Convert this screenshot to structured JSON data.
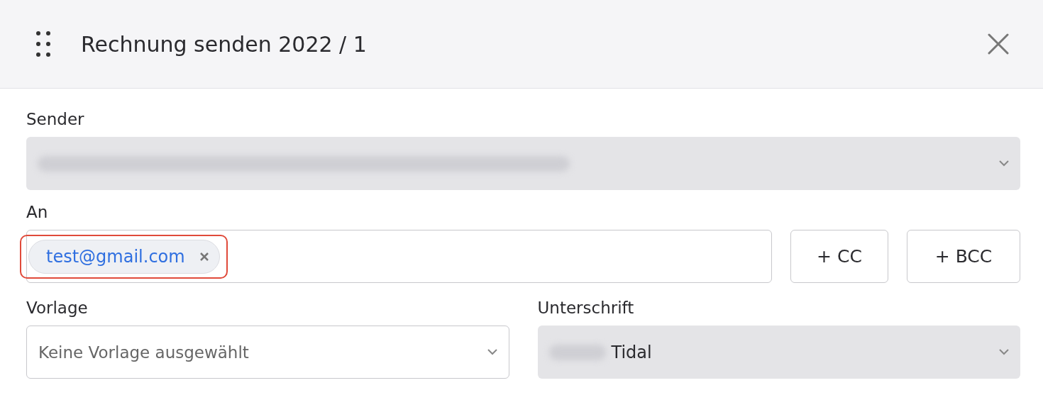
{
  "dialog": {
    "title": "Rechnung senden 2022 / 1"
  },
  "sender": {
    "label": "Sender",
    "disabled": true
  },
  "recipients": {
    "label": "An",
    "tags": [
      {
        "text": "test@gmail.com",
        "highlighted": true
      }
    ],
    "buttons": [
      "+ CC",
      "+ BCC"
    ]
  },
  "template": {
    "label": "Vorlage",
    "placeholder": "Keine Vorlage ausgewählt"
  },
  "signature": {
    "label": "Unterschrift",
    "value": "Tidal",
    "disabled": true
  }
}
